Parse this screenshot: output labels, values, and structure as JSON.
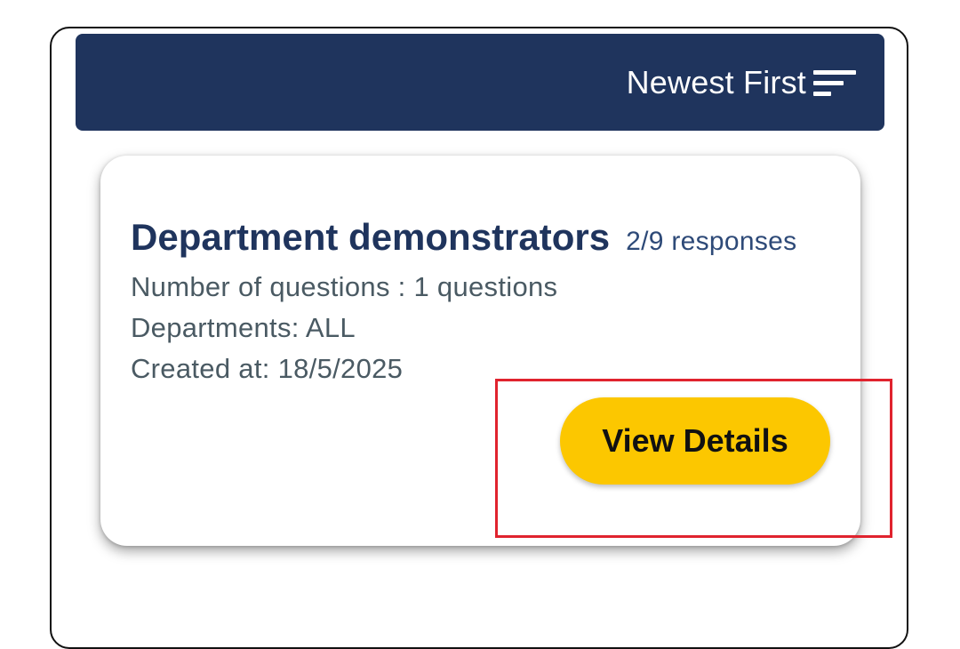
{
  "header": {
    "sort_label": "Newest First",
    "sort_icon": "sort-lines-icon",
    "background_color": "#1f345d"
  },
  "survey_card": {
    "title": "Department demonstrators",
    "responses": "2/9 responses",
    "questions": "Number of questions : 1 questions",
    "departments": "Departments: ALL",
    "created_at": "Created at: 18/5/2025",
    "view_button_label": "View Details",
    "button_color": "#fcc700"
  },
  "highlight_color": "#e0232e"
}
